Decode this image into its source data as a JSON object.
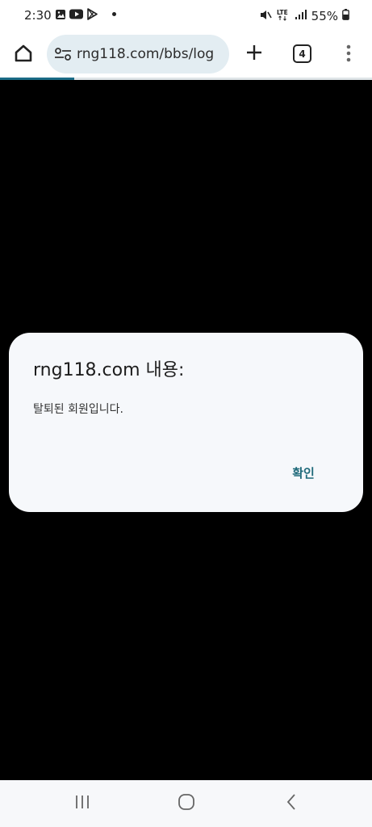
{
  "status_bar": {
    "time": "2:30",
    "battery_percent": "55%",
    "network": "LTE",
    "icons": [
      "gallery-icon",
      "youtube-icon",
      "play-store-icon",
      "notification-dot-icon",
      "mute-icon",
      "lte-icon",
      "signal-icon",
      "battery-icon"
    ]
  },
  "toolbar": {
    "url": "rng118.com/bbs/log",
    "tab_count": "4",
    "icons": [
      "home-icon",
      "site-settings-icon",
      "plus-icon",
      "tab-switcher-icon",
      "more-vert-icon"
    ],
    "page_load_progress": 0.2
  },
  "dialog": {
    "title": "rng118.com 내용:",
    "message": "탈퇴된 회원입니다.",
    "ok_label": "확인"
  },
  "nav_bar": {
    "icons": [
      "recent-apps-icon",
      "home-circle-icon",
      "back-icon"
    ]
  },
  "colors": {
    "accent": "#1f6a7a",
    "omnibox_bg": "#e3edf2",
    "dialog_bg": "#f6f8fb",
    "page_bg": "#000000",
    "progress": "#1a6b86"
  }
}
